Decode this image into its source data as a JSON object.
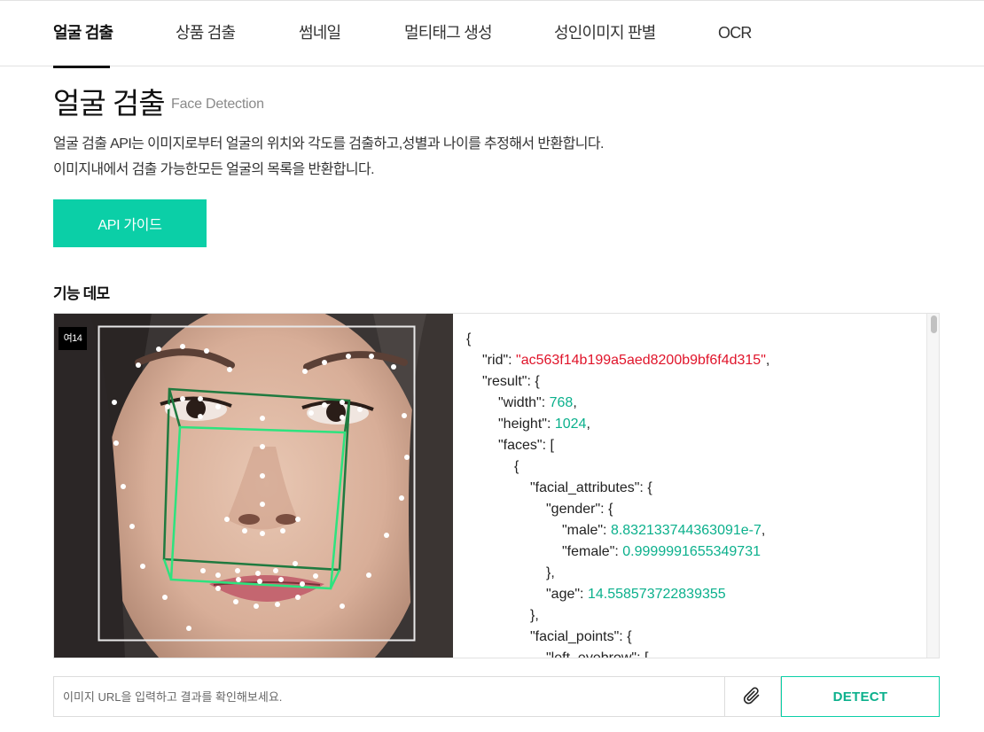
{
  "nav": {
    "tabs": [
      {
        "label": "얼굴 검출",
        "active": true
      },
      {
        "label": "상품 검출",
        "active": false
      },
      {
        "label": "썸네일",
        "active": false
      },
      {
        "label": "멀티태그 생성",
        "active": false
      },
      {
        "label": "성인이미지 판별",
        "active": false
      },
      {
        "label": "OCR",
        "active": false
      }
    ]
  },
  "page": {
    "title": "얼굴 검출",
    "subtitle": "Face Detection",
    "description_1": "얼굴 검출 API는 이미지로부터 얼굴의 위치와 각도를 검출하고,성별과 나이를 추정해서 반환합니다.",
    "description_2": "이미지내에서 검출 가능한모든 얼굴의 목록을 반환합니다.",
    "guide_button": "API 가이드",
    "demo_label": "기능 데모"
  },
  "demo": {
    "age_badge": "여14",
    "json_lines": {
      "l1": "{",
      "l2_key": "\"rid\": ",
      "l2_val": "\"ac563f14b199a5aed8200b9bf6f4d315\"",
      "l2_tail": ",",
      "l3": "\"result\": {",
      "l4_key": "\"width\": ",
      "l4_val": "768",
      "l5_key": "\"height\": ",
      "l5_val": "1024",
      "l6": "\"faces\": [",
      "l7": "{",
      "l8": "\"facial_attributes\": {",
      "l9": "\"gender\": {",
      "l10_key": "\"male\": ",
      "l10_val": "8.832133744363091e-7",
      "l11_key": "\"female\": ",
      "l11_val": "0.9999991655349731",
      "l12": "},",
      "l13_key": "\"age\": ",
      "l13_val": "14.558573722839355",
      "l14": "},",
      "l15": "\"facial_points\": {",
      "l16": "\"left_eyebrow\": ["
    }
  },
  "input": {
    "placeholder": "이미지 URL을 입력하고 결과를 확인해보세요.",
    "detect_label": "DETECT",
    "attach_icon": "paperclip-icon"
  },
  "colors": {
    "accent": "#0bcfa7",
    "json_string": "#e0142a",
    "json_number": "#0bb08c",
    "box_green": "#2de37e"
  }
}
